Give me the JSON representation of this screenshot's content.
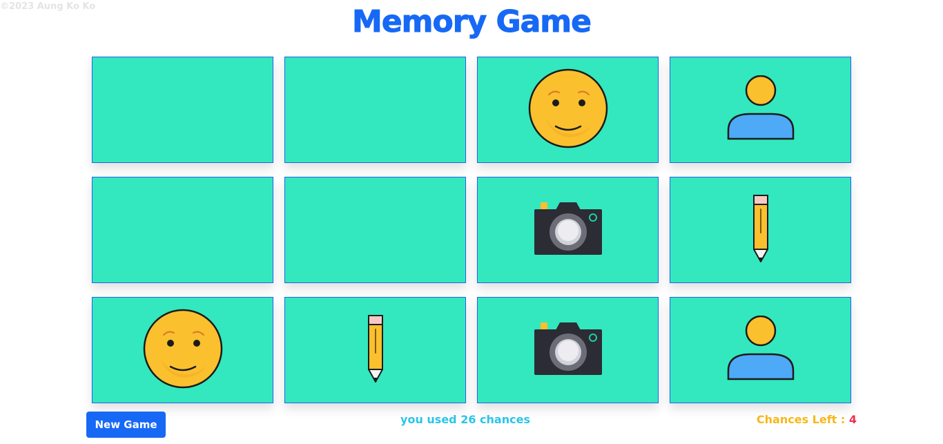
{
  "copyright": "©2023 Aung Ko Ko",
  "title": "Memory Game",
  "cards": [
    {
      "state": "hidden",
      "icon": ""
    },
    {
      "state": "hidden",
      "icon": ""
    },
    {
      "state": "flipped",
      "icon": "smiley-face-icon"
    },
    {
      "state": "flipped",
      "icon": "user-icon"
    },
    {
      "state": "hidden",
      "icon": ""
    },
    {
      "state": "hidden",
      "icon": ""
    },
    {
      "state": "flipped",
      "icon": "camera-icon"
    },
    {
      "state": "flipped",
      "icon": "pencil-icon"
    },
    {
      "state": "flipped",
      "icon": "smiley-face-icon"
    },
    {
      "state": "flipped",
      "icon": "pencil-icon"
    },
    {
      "state": "flipped",
      "icon": "camera-icon"
    },
    {
      "state": "flipped",
      "icon": "user-icon"
    }
  ],
  "footer": {
    "new_game_label": "New Game",
    "used_prefix": "you used ",
    "used_count": "26",
    "used_suffix": " chances",
    "chances_left_label": "Chances Left : ",
    "chances_left_value": "4"
  },
  "colors": {
    "title": "#1769f5",
    "card_bg": "#33e8be",
    "card_border": "#2060f0",
    "button_bg": "#1769f5",
    "used_text": "#2bc4e8",
    "chances_label": "#f7b718",
    "chances_value": "#ef2f4f"
  }
}
